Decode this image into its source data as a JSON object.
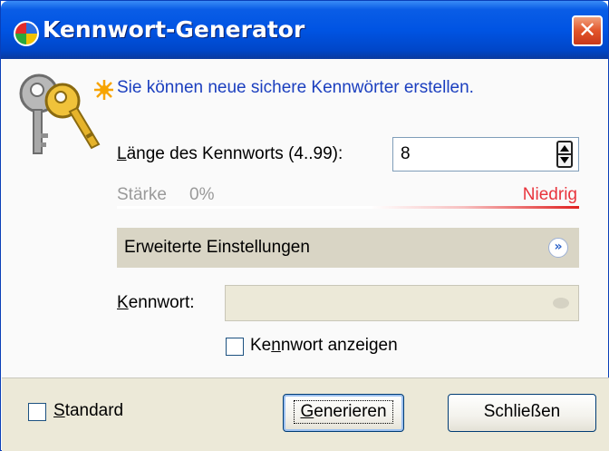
{
  "window": {
    "title": "Kennwort-Generator",
    "close_glyph": "✕",
    "icon": "app-logo-icon"
  },
  "intro_text": "Sie können neue sichere Kennwörter erstellen.",
  "length": {
    "label_prefix": "L",
    "label_rest": "änge des Kennworts (4..99):",
    "value": "8",
    "min": 4,
    "max": 99
  },
  "strength": {
    "label": "Stärke",
    "percent_text": "0%",
    "rating": "Niedrig",
    "colors": {
      "low": "#e02020",
      "rating_text": "#e8343c"
    }
  },
  "advanced": {
    "label": "Erweiterte Einstellungen",
    "expanded": false
  },
  "password": {
    "label_prefix": "K",
    "label_rest": "ennwort:",
    "value": ""
  },
  "show_password": {
    "label_before": "Ke",
    "label_underlined": "n",
    "label_after": "nwort anzeigen",
    "checked": false
  },
  "standard": {
    "label_prefix": "S",
    "label_rest": "tandard",
    "checked": false
  },
  "buttons": {
    "generate_prefix": "G",
    "generate_rest": "enerieren",
    "close_label": "Schließen"
  },
  "colors": {
    "titlebar": "#0054e3",
    "intro_text": "#1b3fbf",
    "close_button": "#e2542a"
  }
}
